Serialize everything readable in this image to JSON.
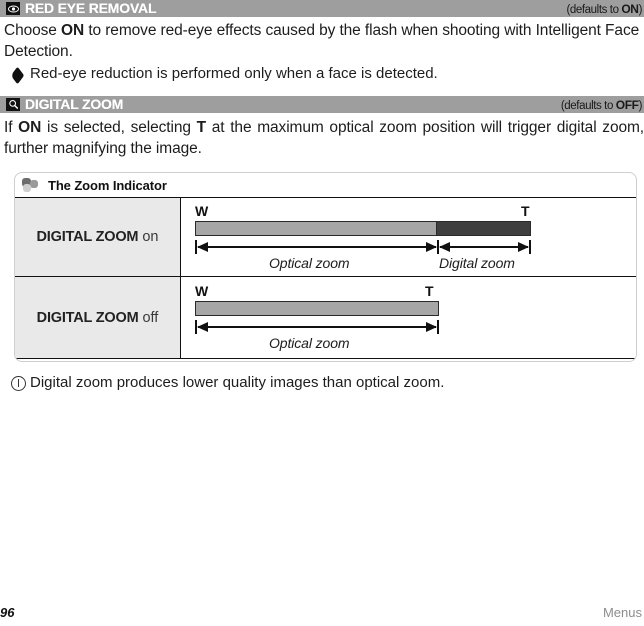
{
  "page": {
    "number": "96",
    "section_label": "Menus"
  },
  "sections": [
    {
      "icon": "eye-icon",
      "title": "RED EYE REMOVAL",
      "default_prefix": "(defaults to ",
      "default_value": "ON",
      "default_suffix": ")",
      "body_html": "Choose <b>ON</b> to remove red-eye effects caused by the flash when shooting with Intelligent Face Detection.",
      "note": {
        "bullet": "tag-bullet-icon",
        "text": "Red-eye reduction is performed only when a face is detected."
      }
    },
    {
      "icon": "magnifier-icon",
      "title": "DIGITAL ZOOM",
      "default_prefix": "(defaults to ",
      "default_value": "OFF",
      "default_suffix": ")",
      "body_html": "If <b>ON</b> is selected, selecting <b>T</b> at the maximum optical zoom position will trigger digital zoom, further magnifying the image."
    }
  ],
  "tipbox": {
    "icon": "three-dots-icon",
    "title": "The Zoom Indicator",
    "rows": [
      {
        "label_bold": "DIGITAL ZOOM",
        "label_state": "on",
        "wide_label": "W",
        "tele_label": "T",
        "segments": [
          {
            "name": "optical",
            "color": "#a6a6a6",
            "width_pct": 72
          },
          {
            "name": "digital",
            "color": "#3f3f3f",
            "width_pct": 28
          }
        ],
        "measures": [
          {
            "label": "Optical zoom",
            "span_pct": 72
          },
          {
            "label": "Digital zoom",
            "span_pct": 28
          }
        ]
      },
      {
        "label_bold": "DIGITAL ZOOM",
        "label_state": "off",
        "wide_label": "W",
        "tele_label": "T",
        "segments": [
          {
            "name": "optical",
            "color": "#a6a6a6",
            "width_pct": 100
          }
        ],
        "measures": [
          {
            "label": "Optical zoom",
            "span_pct": 100
          }
        ]
      }
    ]
  },
  "caution": {
    "icon": "caution-icon",
    "text": "Digital zoom produces lower quality images than optical zoom."
  },
  "colors": {
    "bar_background": "#9e9e9e",
    "optical_segment": "#a6a6a6",
    "digital_segment": "#3f3f3f",
    "label_cell": "#e9e9e9",
    "box_border": "#cfcfcf"
  }
}
